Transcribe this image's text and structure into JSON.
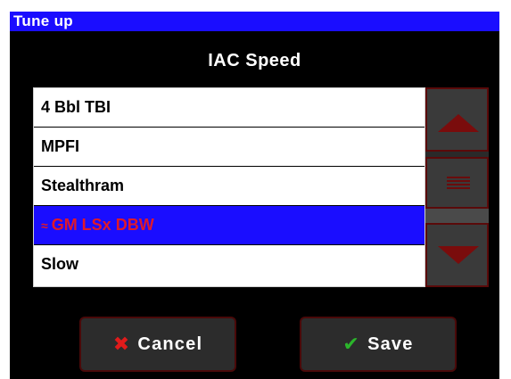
{
  "window": {
    "title": "Tune up"
  },
  "heading": "IAC Speed",
  "list": {
    "items": [
      {
        "label": "4 Bbl TBI",
        "selected": false
      },
      {
        "label": "MPFI",
        "selected": false
      },
      {
        "label": "Stealthram",
        "selected": false
      },
      {
        "label": "GM LSx DBW",
        "selected": true,
        "marker": "≈"
      },
      {
        "label": "Slow",
        "selected": false
      }
    ]
  },
  "buttons": {
    "cancel_label": "Cancel",
    "save_label": "Save"
  },
  "icons": {
    "cancel": "x-icon",
    "save": "check-icon",
    "scroll_up": "triangle-up-icon",
    "scroll_down": "triangle-down-icon",
    "scroll_thumb": "grip-icon"
  },
  "colors": {
    "titlebar": "#1a0dff",
    "selection_bg": "#1a0dff",
    "selection_text": "#e0192a",
    "accent_dark_red": "#7a0c0c",
    "cancel_icon": "#e11b1b",
    "save_icon": "#2bb52b"
  }
}
